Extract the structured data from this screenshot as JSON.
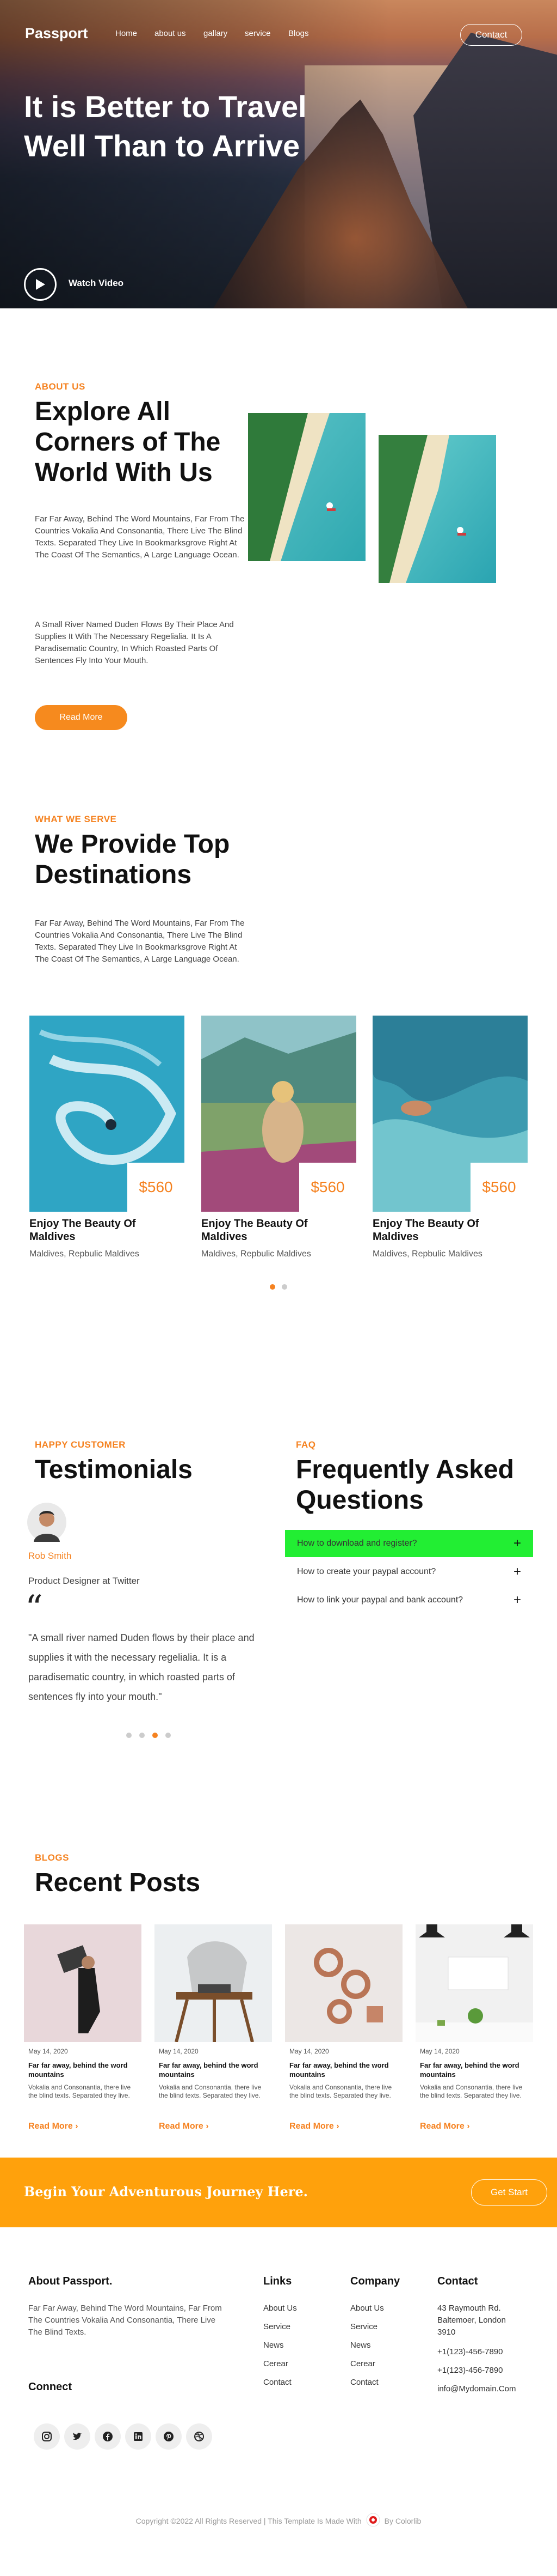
{
  "nav": {
    "logo": "Passport",
    "links": [
      "Home",
      "about us",
      "gallary",
      "service",
      "Blogs"
    ],
    "contact": "Contact"
  },
  "hero": {
    "title": "It is Better to Travel Well Than to Arrive",
    "watch_video": "Watch Video"
  },
  "about": {
    "eyebrow": "ABOUT US",
    "title": "Explore All Corners of The World With Us",
    "para1": "Far Far Away, Behind The Word Mountains, Far From The Countries Vokalia And Consonantia, There Live The Blind Texts. Separated They Live In Bookmarksgrove Right At The Coast Of The Semantics, A Large Language Ocean.",
    "para2": "A Small River Named Duden Flows By Their Place And Supplies It With The Necessary Regelialia. It Is A Paradisematic Country, In Which Roasted Parts Of Sentences Fly Into Your Mouth.",
    "button": "Read More"
  },
  "serve": {
    "eyebrow": "WHAT WE SERVE",
    "title": "We Provide Top Destinations",
    "para": "Far Far Away, Behind The Word Mountains, Far From The Countries Vokalia And Consonantia, There Live The Blind Texts. Separated They Live In Bookmarksgrove Right At The Coast Of The Semantics, A Large Language Ocean.",
    "cards": [
      {
        "price": "$560",
        "title": "Enjoy The Beauty Of Maldives",
        "sub": "Maldives, Repbulic Maldives"
      },
      {
        "price": "$560",
        "title": "Enjoy The Beauty Of Maldives",
        "sub": "Maldives, Repbulic Maldives"
      },
      {
        "price": "$560",
        "title": "Enjoy The Beauty Of Maldives",
        "sub": "Maldives, Repbulic Maldives"
      }
    ]
  },
  "testimonials": {
    "eyebrow": "HAPPY CUSTOMER",
    "title": "Testimonials",
    "name": "Rob Smith",
    "role": "Product Designer at Twitter",
    "quote_mark": "“",
    "quote": "\"A small river named Duden flows by their place and supplies it with the necessary regelialia. It is a paradisematic country, in which roasted parts of sentences fly into your mouth.\""
  },
  "faq": {
    "eyebrow": "FAQ",
    "title": "Frequently Asked Questions",
    "items": [
      {
        "q": "How to download and register?",
        "icon": "+"
      },
      {
        "q": "How to create your paypal account?",
        "icon": "+"
      },
      {
        "q": "How to link your paypal and bank account?",
        "icon": "+"
      }
    ],
    "active_color": "#22ee33"
  },
  "blog": {
    "eyebrow": "BLOGS",
    "title": "Recent Posts",
    "posts": [
      {
        "date": "May 14, 2020",
        "title": "Far far away, behind the word mountains",
        "text": "Vokalia and Consonantia, there live the blind texts. Separated they live.",
        "more": "Read More"
      },
      {
        "date": "May 14, 2020",
        "title": "Far far away, behind the word mountains",
        "text": "Vokalia and Consonantia, there live the blind texts. Separated they live.",
        "more": "Read More"
      },
      {
        "date": "May 14, 2020",
        "title": "Far far away, behind the word mountains",
        "text": "Vokalia and Consonantia, there live the blind texts. Separated they live.",
        "more": "Read More"
      },
      {
        "date": "May 14, 2020",
        "title": "Far far away, behind the word mountains",
        "text": "Vokalia and Consonantia, there live the blind texts. Separated they live.",
        "more": "Read More"
      }
    ]
  },
  "cta": {
    "text": "Begin Your Adventurous Journey Here.",
    "button": "Get Start",
    "color": "#ffa10c"
  },
  "footer": {
    "about_title": "About Passport.",
    "about_text": "Far Far Away, Behind The Word Mountains, Far From The Countries Vokalia And Consonantia, There Live The Blind Texts.",
    "connect": "Connect",
    "social": [
      "instagram-icon",
      "twitter-icon",
      "facebook-icon",
      "linkedin-icon",
      "pinterest-icon",
      "dribbble-icon"
    ],
    "links_title": "Links",
    "links": [
      "About Us",
      "Service",
      "News",
      "Cerear",
      "Contact"
    ],
    "company_title": "Company",
    "company": [
      "About Us",
      "Service",
      "News",
      "Cerear",
      "Contact"
    ],
    "contact_title": "Contact",
    "address": "43 Raymouth Rd. Baltemoer, London 3910",
    "phone1": "+1(123)-456-7890",
    "phone2": "+1(123)-456-7890",
    "email": "info@Mydomain.Com",
    "copyright": "Copyright ©2022 All Rights Reserved | This Template Is Made With",
    "by": "By Colorlib"
  }
}
